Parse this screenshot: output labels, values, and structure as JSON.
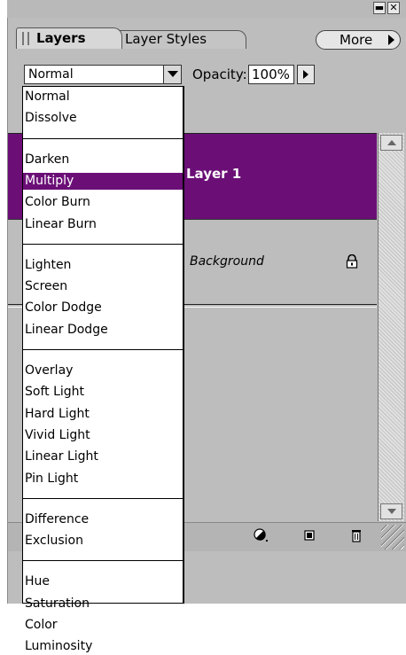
{
  "tabs": [
    {
      "label": "Layers",
      "active": true
    },
    {
      "label": "Layer Styles",
      "active": false
    }
  ],
  "more_button": {
    "label": "More"
  },
  "blend_mode": {
    "value": "Normal"
  },
  "opacity": {
    "label": "Opacity:",
    "value": "100%"
  },
  "layers": [
    {
      "name": "Layer 1",
      "selected": true,
      "locked": false
    },
    {
      "name": "Background",
      "selected": false,
      "locked": true
    }
  ],
  "blend_menu": {
    "selected": "Multiply",
    "groups": [
      [
        "Normal",
        "Dissolve"
      ],
      [
        "Darken",
        "Multiply",
        "Color Burn",
        "Linear Burn"
      ],
      [
        "Lighten",
        "Screen",
        "Color Dodge",
        "Linear Dodge"
      ],
      [
        "Overlay",
        "Soft Light",
        "Hard Light",
        "Vivid Light",
        "Linear Light",
        "Pin Light"
      ],
      [
        "Difference",
        "Exclusion"
      ],
      [
        "Hue",
        "Saturation",
        "Color",
        "Luminosity"
      ]
    ]
  },
  "footer_icons": [
    "adjustment-layer-icon",
    "new-layer-icon",
    "trash-icon"
  ],
  "colors": {
    "selection": "#6b0f77",
    "panel": "#bdbdbd"
  }
}
